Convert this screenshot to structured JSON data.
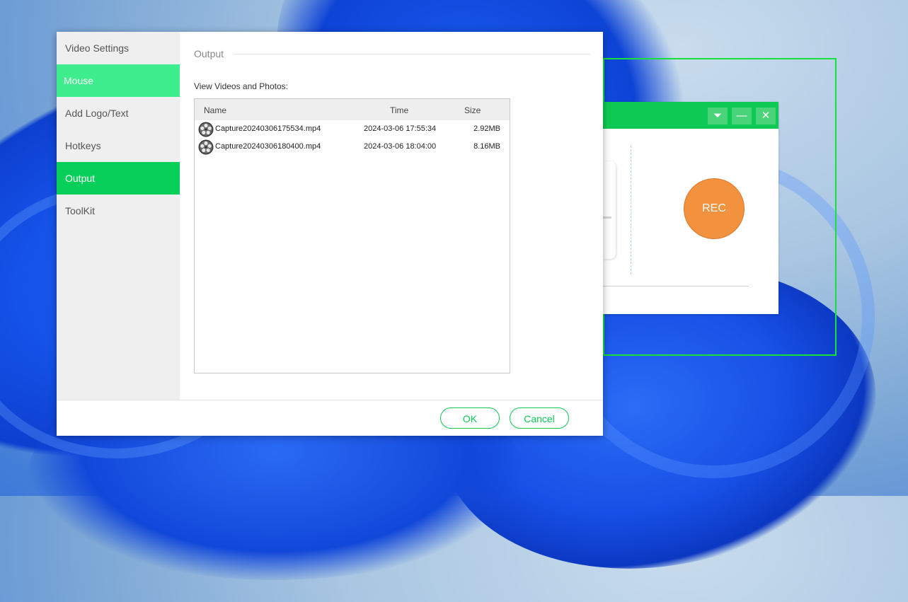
{
  "sidebar": {
    "items": [
      {
        "label": "Video Settings",
        "state": "normal"
      },
      {
        "label": "Mouse",
        "state": "hover"
      },
      {
        "label": "Add Logo/Text",
        "state": "normal"
      },
      {
        "label": "Hotkeys",
        "state": "normal"
      },
      {
        "label": "Output",
        "state": "active"
      },
      {
        "label": "ToolKit",
        "state": "normal"
      }
    ]
  },
  "output": {
    "section_title": "Output",
    "list_label": "View Videos and Photos:",
    "columns": {
      "name": "Name",
      "time": "Time",
      "size": "Size"
    },
    "files": [
      {
        "name": "Capture20240306175534.mp4",
        "time": "2024-03-06 17:55:34",
        "size": "2.92MB",
        "icon": "film-reel-icon"
      },
      {
        "name": "Capture20240306180400.mp4",
        "time": "2024-03-06 18:04:00",
        "size": "8.16MB",
        "icon": "film-reel-icon"
      }
    ]
  },
  "footer": {
    "ok_label": "OK",
    "cancel_label": "Cancel"
  },
  "recorder": {
    "rec_label": "REC",
    "dropdown_glyph": "⏷",
    "minimize_glyph": "—",
    "close_glyph": "✕"
  },
  "colors": {
    "accent": "#0fc955",
    "sidebar_hover": "#3eed8d",
    "sidebar_active": "#07cf59",
    "rec_button": "#f2923e",
    "capture_border": "#17e03a"
  }
}
